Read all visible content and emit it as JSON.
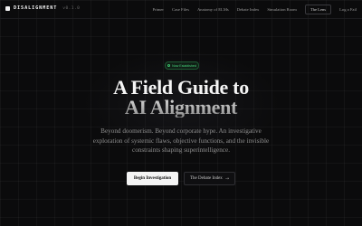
{
  "brand": {
    "name": "DISALIGNMENT",
    "version": "v0.1.0"
  },
  "nav": {
    "links": [
      "Primer",
      "Case Files",
      "Anatomy of ELMs",
      "Debate Index",
      "Simulation Room",
      "The Lens"
    ],
    "cta": "Log a Fail"
  },
  "hero": {
    "badge": "Now Established",
    "title_line1": "A Field Guide to",
    "title_line2": "AI Alignment",
    "subtitle": "Beyond doomerism. Beyond corporate hype. An investigative exploration of systemic flaws, objective functions, and the invisible constraints shaping superintelligence.",
    "primary_button": "Begin Investigation",
    "secondary_button": "The Debate Index",
    "secondary_icon": "arrow-right-icon"
  },
  "colors": {
    "background": "#0b0b0c",
    "accent_green": "#47d37a",
    "primary_button_bg": "#f4f4f4"
  }
}
